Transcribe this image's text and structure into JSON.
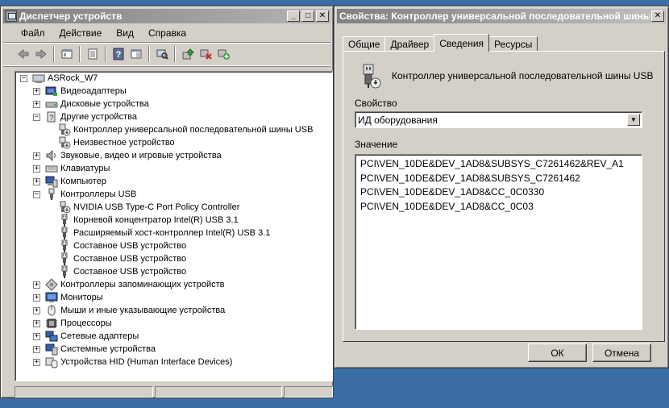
{
  "device_manager": {
    "title": "Диспетчер устройств",
    "menu": [
      "Файл",
      "Действие",
      "Вид",
      "Справка"
    ],
    "toolbar_icons": [
      "back-icon",
      "forward-icon",
      "properties-icon",
      "list-icon",
      "help-icon",
      "console-tree-icon",
      "scan-hardware-icon",
      "update-driver-icon",
      "disable-device-icon",
      "uninstall-device-icon"
    ],
    "tree": [
      {
        "label": "ASRock_W7",
        "level": 0,
        "expander": "−",
        "icon": "computer-root-icon"
      },
      {
        "label": "Видеоадаптеры",
        "level": 1,
        "expander": "+",
        "icon": "display-adapter-icon"
      },
      {
        "label": "Дисковые устройства",
        "level": 1,
        "expander": "+",
        "icon": "disk-drive-icon"
      },
      {
        "label": "Другие устройства",
        "level": 1,
        "expander": "−",
        "icon": "unknown-device-icon"
      },
      {
        "label": "Контроллер универсальной последовательной шины USB",
        "level": 2,
        "expander": "",
        "icon": "warning-device-icon"
      },
      {
        "label": "Неизвестное устройство",
        "level": 2,
        "expander": "",
        "icon": "warning-device-icon"
      },
      {
        "label": "Звуковые, видео и игровые устройства",
        "level": 1,
        "expander": "+",
        "icon": "sound-icon"
      },
      {
        "label": "Клавиатуры",
        "level": 1,
        "expander": "+",
        "icon": "keyboard-icon"
      },
      {
        "label": "Компьютер",
        "level": 1,
        "expander": "+",
        "icon": "computer-icon"
      },
      {
        "label": "Контроллеры USB",
        "level": 1,
        "expander": "−",
        "icon": "usb-icon"
      },
      {
        "label": "NVIDIA USB Type-C Port Policy Controller",
        "level": 2,
        "expander": "",
        "icon": "warning-usb-icon"
      },
      {
        "label": "Корневой концентратор Intel(R) USB 3.1",
        "level": 2,
        "expander": "",
        "icon": "usb-plug-icon"
      },
      {
        "label": "Расширяемый хост-контроллер Intel(R) USB 3.1",
        "level": 2,
        "expander": "",
        "icon": "usb-plug-icon"
      },
      {
        "label": "Составное USB устройство",
        "level": 2,
        "expander": "",
        "icon": "usb-plug-icon"
      },
      {
        "label": "Составное USB устройство",
        "level": 2,
        "expander": "",
        "icon": "usb-plug-icon"
      },
      {
        "label": "Составное USB устройство",
        "level": 2,
        "expander": "",
        "icon": "usb-plug-icon"
      },
      {
        "label": "Контроллеры запоминающих устройств",
        "level": 1,
        "expander": "+",
        "icon": "storage-controller-icon"
      },
      {
        "label": "Мониторы",
        "level": 1,
        "expander": "+",
        "icon": "monitor-icon"
      },
      {
        "label": "Мыши и иные указывающие устройства",
        "level": 1,
        "expander": "+",
        "icon": "mouse-icon"
      },
      {
        "label": "Процессоры",
        "level": 1,
        "expander": "+",
        "icon": "processor-icon"
      },
      {
        "label": "Сетевые адаптеры",
        "level": 1,
        "expander": "+",
        "icon": "network-adapter-icon"
      },
      {
        "label": "Системные устройства",
        "level": 1,
        "expander": "+",
        "icon": "system-device-icon"
      },
      {
        "label": "Устройства HID (Human Interface Devices)",
        "level": 1,
        "expander": "+",
        "icon": "hid-icon"
      }
    ]
  },
  "properties": {
    "title": "Свойства: Контроллер универсальной последовательной шины USB",
    "tabs": [
      "Общие",
      "Драйвер",
      "Сведения",
      "Ресурсы"
    ],
    "active_tab": "Сведения",
    "device_name": "Контроллер универсальной последовательной шины USB",
    "property_label": "Свойство",
    "property_value": "ИД оборудования",
    "value_label": "Значение",
    "values": [
      "PCI\\VEN_10DE&DEV_1AD8&SUBSYS_C7261462&REV_A1",
      "PCI\\VEN_10DE&DEV_1AD8&SUBSYS_C7261462",
      "PCI\\VEN_10DE&DEV_1AD8&CC_0C0330",
      "PCI\\VEN_10DE&DEV_1AD8&CC_0C03"
    ],
    "ok_label": "ОК",
    "cancel_label": "Отмена"
  },
  "colors": {
    "desktop": "#3a6ea5",
    "face": "#d4d0c8",
    "title_inactive": "#808080"
  }
}
